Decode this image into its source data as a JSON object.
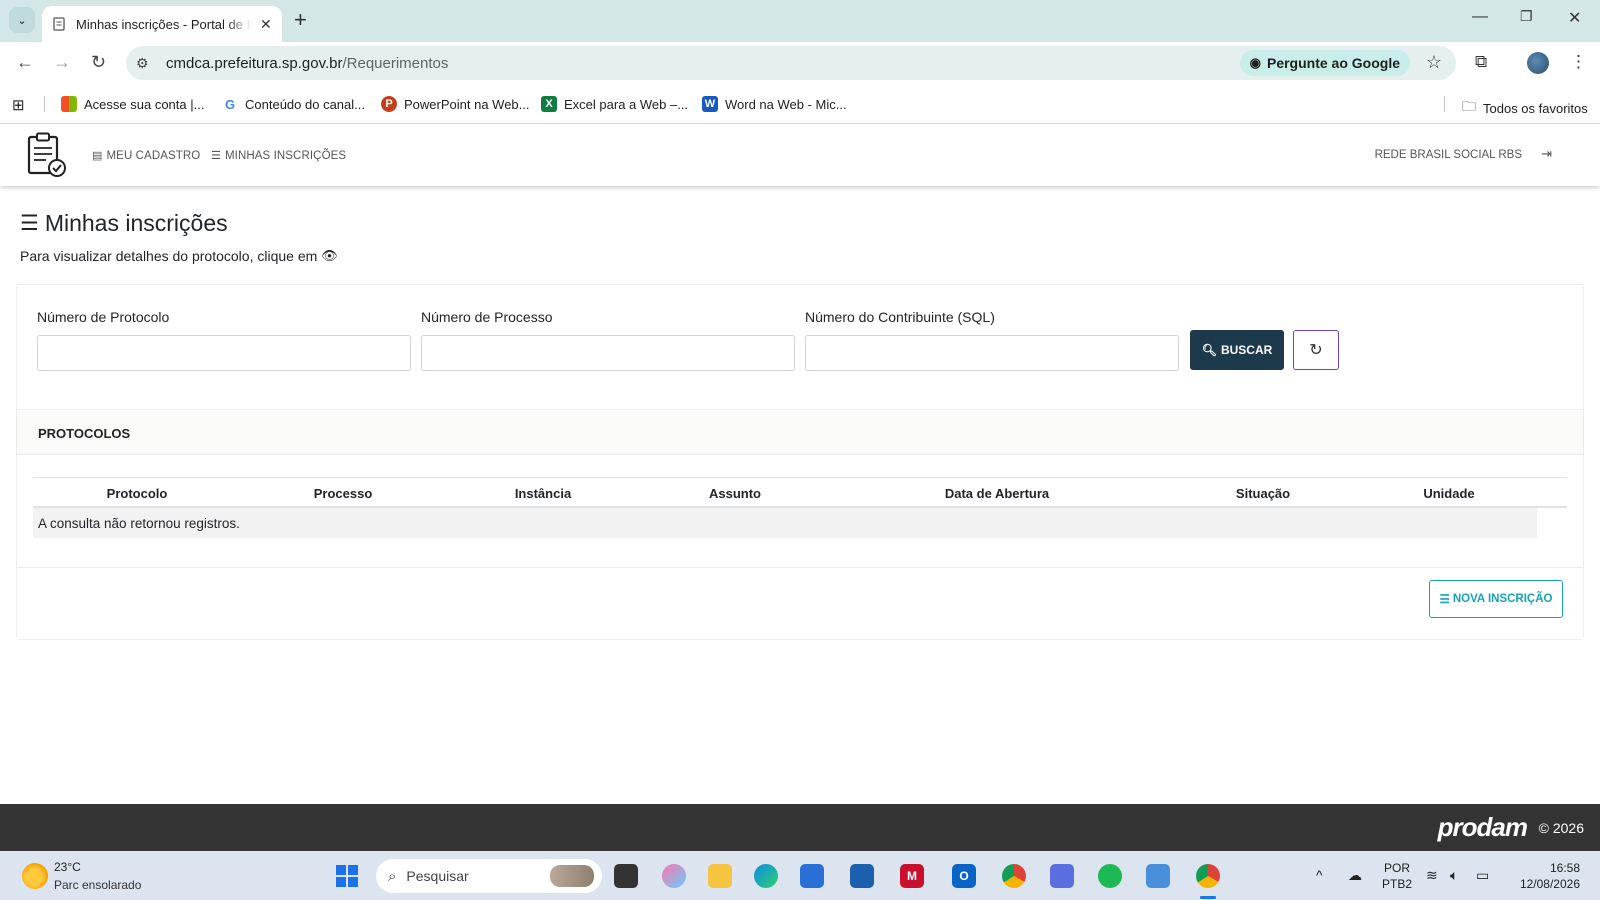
{
  "browser": {
    "tab_title": "Minhas inscrições - Portal de Inscrições",
    "url_host": "cmdca.prefeitura.sp.gov.br",
    "url_path": "/Requerimentos",
    "ask_google": "Pergunte ao Google",
    "bookmarks": [
      {
        "label": "Acesse sua conta |...",
        "icon": "microsoft-icon"
      },
      {
        "label": "Conteúdo do canal...",
        "icon": "google-icon"
      },
      {
        "label": "PowerPoint na Web...",
        "icon": "powerpoint-icon"
      },
      {
        "label": "Excel para a Web –...",
        "icon": "excel-icon"
      },
      {
        "label": "Word na Web - Mic...",
        "icon": "word-icon"
      }
    ],
    "all_bookmarks": "Todos os favoritos"
  },
  "header": {
    "nav": [
      {
        "label": "MEU CADASTRO",
        "icon": "id-card-icon"
      },
      {
        "label": "MINHAS INSCRIÇÕES",
        "icon": "list-icon"
      }
    ],
    "org_name": "REDE BRASIL SOCIAL RBS"
  },
  "page": {
    "title": "Minhas inscrições",
    "subtitle": "Para visualizar detalhes do protocolo, clique em"
  },
  "search_form": {
    "fields": [
      {
        "label": "Número de Protocolo",
        "value": "",
        "placeholder": ""
      },
      {
        "label": "Número de Processo",
        "value": "",
        "placeholder": ""
      },
      {
        "label": "Número do Contribuinte (SQL)",
        "value": "",
        "placeholder": ""
      }
    ],
    "search_button": "BUSCAR"
  },
  "protocols": {
    "section_title": "PROTOCOLOS",
    "columns": [
      "Protocolo",
      "Processo",
      "Instância",
      "Assunto",
      "Data de Abertura",
      "Situação",
      "Unidade"
    ],
    "empty_message": "A consulta não retornou registros.",
    "new_button": "NOVA INSCRIÇÃO"
  },
  "footer": {
    "brand": "prodam",
    "copyright": "© 2026"
  },
  "taskbar": {
    "temperature": "23°C",
    "weather": "Parc ensolarado",
    "search_label": "Pesquisar",
    "lang_line1": "POR",
    "lang_line2": "PTB2",
    "time": "16:58",
    "date": "12/08/2026"
  },
  "colors": {
    "primary_dark": "#1c3a4b",
    "info": "#17a2b8",
    "purple_outline": "#6f42c1",
    "footer_bg": "#343434",
    "chrome_bg": "#d2e7e6"
  }
}
